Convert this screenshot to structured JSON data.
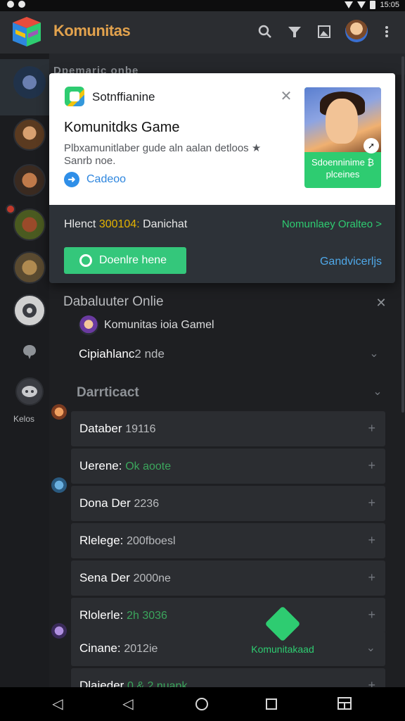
{
  "status_bar": {
    "time": "15:05"
  },
  "app_bar": {
    "title": "Komunitas",
    "icons": [
      "search-icon",
      "filter-icon",
      "image-icon",
      "more-icon"
    ]
  },
  "sidebar": {
    "label": "Kelos"
  },
  "server_header": {
    "title": "Dpemaric onbe"
  },
  "card": {
    "brand": "Sotnffianine",
    "title": "Komunitdks Game",
    "description": "Plbxamunitlaber gude aln aalan detloos ★ Sanrb noe.",
    "link_label": "Cadeoo",
    "promo_text": "Sdoenninime ₿ plceines"
  },
  "stats": {
    "prefix": "Hlenct",
    "count": "300104:",
    "suffix": "Danichat",
    "right_link": "Nomunlaey Oralteo >"
  },
  "actions": {
    "join_label": "Doenlre hene",
    "secondary_label": "Gandvicerljs"
  },
  "section1": {
    "title": "Dabaluuter Onlie",
    "sub_label": "Komunitas ioia Gamel",
    "cat_label": "Cipiahlanc",
    "cat_value": "2 nde"
  },
  "section2": {
    "title": "Darrticact"
  },
  "rows": [
    {
      "label": "Databer",
      "value": "19116",
      "value_color": "muted"
    },
    {
      "label": "Uerene:",
      "value": "Ok aoote",
      "value_color": "green"
    },
    {
      "label": "Dona Der",
      "value": "2236",
      "value_color": "muted"
    },
    {
      "label": "Rlelege:",
      "value": "200fboesl",
      "value_color": "muted"
    },
    {
      "label": "Sena Der",
      "value": "2000ne",
      "value_color": "muted"
    },
    {
      "label": "Rlolerle:",
      "value": "2h 3036",
      "value_color": "green"
    },
    {
      "label": "Cinane:",
      "value": "2012ie",
      "value_color": "muted"
    },
    {
      "label": "Dlaieder",
      "value": "0.& 2 nuapk",
      "value_color": "green"
    }
  ],
  "watermark": {
    "label": "Komunitakaad"
  },
  "colors": {
    "accent_green": "#34c77b",
    "title_orange": "#e2a24d",
    "link_blue": "#4fa8e8",
    "background": "#1e1f22"
  }
}
